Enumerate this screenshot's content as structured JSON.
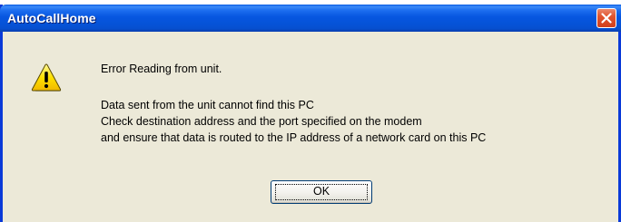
{
  "window": {
    "title": "AutoCallHome",
    "close_icon": "close-icon"
  },
  "message": {
    "icon": "warning-icon",
    "heading": "Error Reading from unit.",
    "lines": [
      "Data sent from the unit cannot find this PC",
      "Check destination address and the port specified on the modem",
      "and ensure that data is routed to the IP address of a network card on this PC"
    ]
  },
  "buttons": {
    "ok_label": "OK"
  },
  "colors": {
    "titlebar": "#0553d8",
    "close_button": "#e2552f",
    "dialog_background": "#ece9d8",
    "warning_fill": "#ffd800"
  }
}
